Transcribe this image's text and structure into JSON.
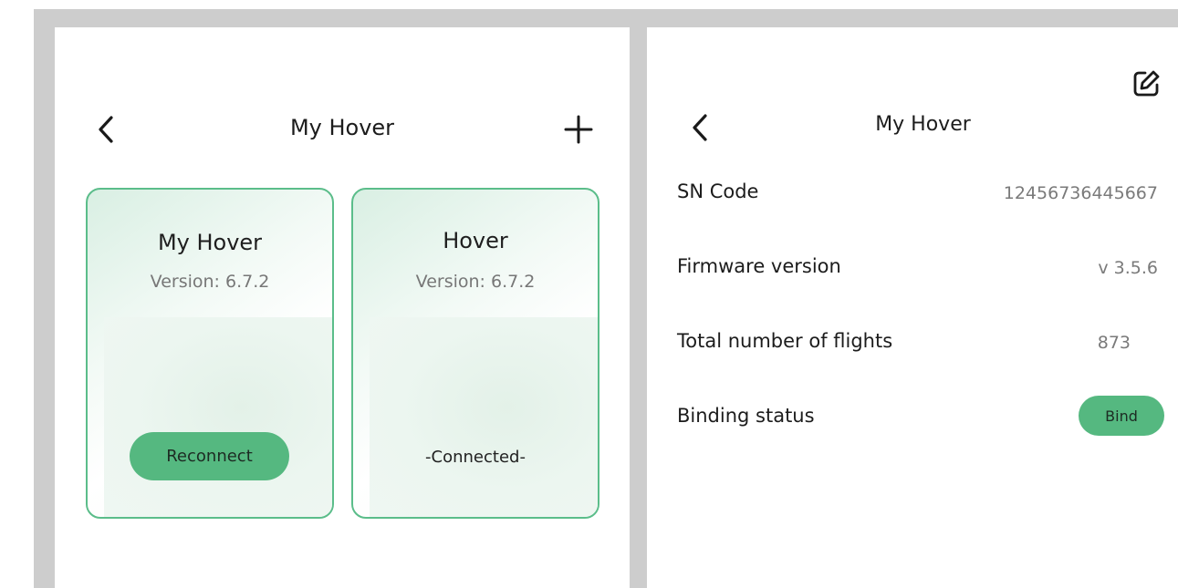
{
  "left_screen": {
    "header": {
      "title": "My Hover",
      "back_icon": "chevron-left-icon",
      "add_icon": "plus-icon"
    },
    "devices": [
      {
        "name": "My Hover",
        "version": "Version: 6.7.2",
        "action_label": "Reconnect"
      },
      {
        "name": "Hover",
        "version": "Version: 6.7.2",
        "status_text": "-Connected-"
      }
    ]
  },
  "right_screen": {
    "header": {
      "title": "My Hover",
      "back_icon": "chevron-left-icon",
      "edit_icon": "edit-icon"
    },
    "details": [
      {
        "label": "SN Code",
        "value": "12456736445667"
      },
      {
        "label": "Firmware version",
        "value": "v 3.5.6"
      },
      {
        "label": "Total number of flights",
        "value": "873"
      },
      {
        "label": "Binding status",
        "action_label": "Bind"
      }
    ]
  },
  "colors": {
    "accent": "#55b880",
    "card_border": "#5bbd8a",
    "backdrop": "#cdcdcd"
  }
}
